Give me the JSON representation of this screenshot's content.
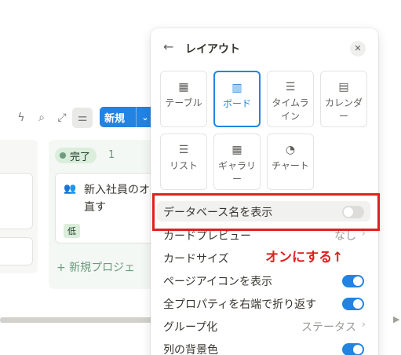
{
  "toolbar": {
    "new_label": "新規"
  },
  "board": {
    "done_group": {
      "label": "完了",
      "count": "1",
      "card_title": "新入社員のオ見直す",
      "card_priority": "低",
      "new_project_label": "+ 新規プロジェ"
    }
  },
  "layout_panel": {
    "title": "レイアウト",
    "layouts": [
      {
        "label": "テーブル",
        "icon": "table-icon"
      },
      {
        "label": "ボード",
        "icon": "board-icon"
      },
      {
        "label": "タイムライン",
        "icon": "timeline-icon"
      },
      {
        "label": "カレンダー",
        "icon": "calendar-icon"
      },
      {
        "label": "リスト",
        "icon": "list-icon"
      },
      {
        "label": "ギャラリー",
        "icon": "gallery-icon"
      },
      {
        "label": "チャート",
        "icon": "chart-icon"
      }
    ],
    "selected_layout": "ボード",
    "settings": [
      {
        "label": "データベース名を表示",
        "toggle": false
      },
      {
        "label": "カードプレビュー",
        "value": "なし"
      },
      {
        "label": "カードサイズ"
      },
      {
        "label": "ページアイコンを表示",
        "toggle": true
      },
      {
        "label": "全プロパティを右端で折り返す",
        "toggle": true
      },
      {
        "label": "グループ化",
        "value": "ステータス"
      },
      {
        "label": "列の背景色",
        "toggle": true
      }
    ]
  },
  "annotation": {
    "text": "オンにする↑",
    "color": "#e02020"
  },
  "colors": {
    "accent": "#2383e2",
    "done_tag_bg": "#dbeddb"
  }
}
